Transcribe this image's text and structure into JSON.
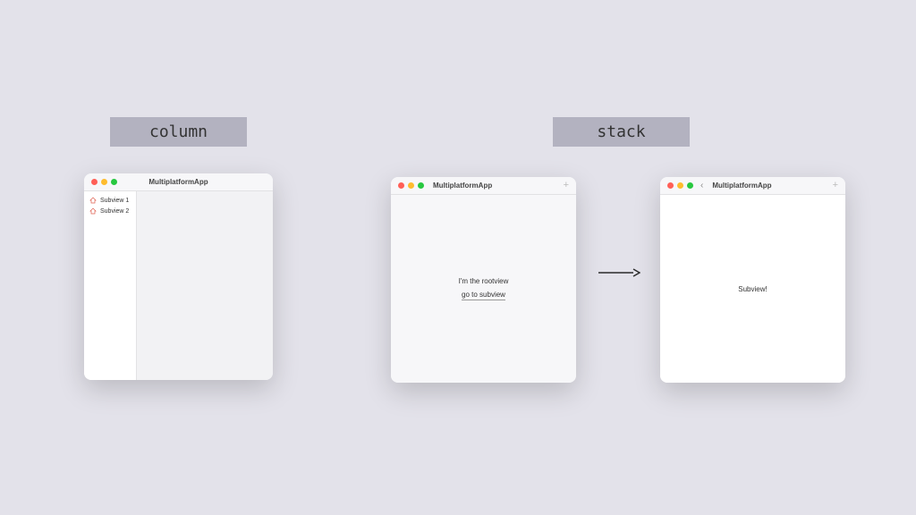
{
  "labels": {
    "column": "column",
    "stack": "stack"
  },
  "win1": {
    "title": "MultiplatformApp",
    "sidebar": {
      "items": [
        {
          "label": "Subview 1"
        },
        {
          "label": "Subview 2"
        }
      ]
    }
  },
  "win2": {
    "title": "MultiplatformApp",
    "root_text": "I'm the rootview",
    "link_text": "go to subview"
  },
  "win3": {
    "title": "MultiplatformApp",
    "content_text": "Subview!"
  }
}
